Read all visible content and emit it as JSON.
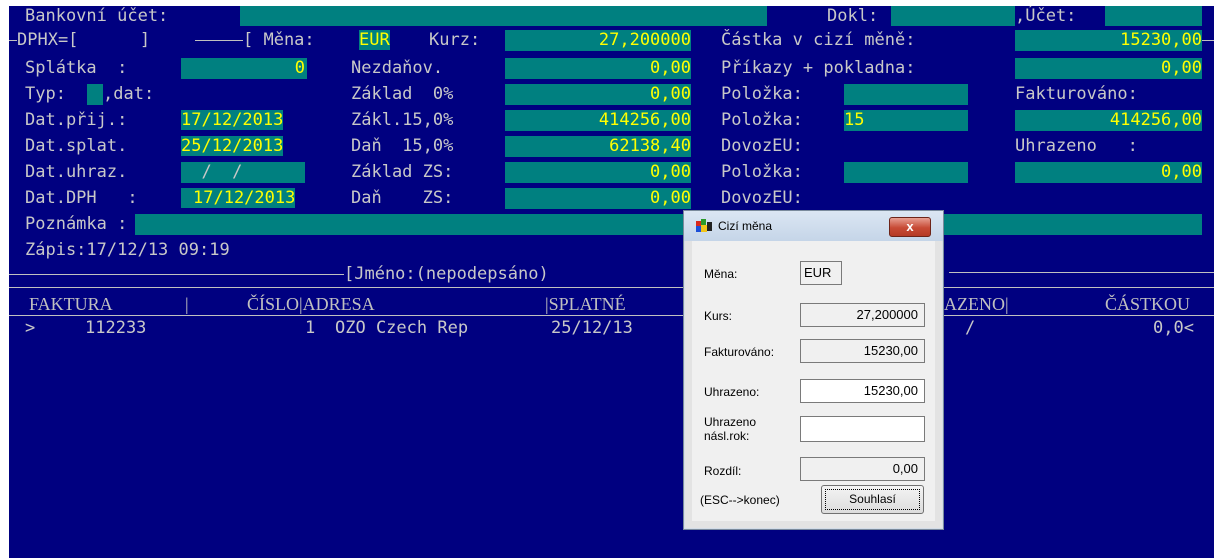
{
  "header": {
    "bank_account_label": "Bankovní účet:",
    "dokl_label": "Dokl:",
    "ucet_label": ",Účet:",
    "dphx_line": "DPHX=[      ]",
    "mena_label": "[ Měna:",
    "mena_value": "EUR",
    "kurz_label": "Kurz:",
    "kurz_value": "27,200000",
    "castka_label": "Částka v cizí měně:",
    "castka_value": "15230,00",
    "splatka_label": "Splátka  :",
    "splatka_value": "0",
    "nezdanov_label": "Nezdaňov.",
    "nezdanov_value": "0,00",
    "prikazy_label": "Příkazy + pokladna:",
    "prikazy_value": "0,00",
    "typ_label": "Typ:",
    "dat_label": ",dat:",
    "zaklad0_label": "Základ  0%",
    "zaklad0_value": "0,00",
    "polozka1_label": "Položka:",
    "fakturovano_label": "Fakturováno:",
    "datprij_label": "Dat.přij.:",
    "datprij_value": "17/12/2013",
    "zakl15_label": "Zákl.15,0%",
    "zakl15_value": "414256,00",
    "polozka2_label": "Položka:",
    "polozka2_value": "15",
    "fakturovano_value": "414256,00",
    "datsplat_label": "Dat.splat.",
    "datsplat_value": "25/12/2013",
    "dan15_label": "Daň  15,0%",
    "dan15_value": "62138,40",
    "dovozeu1_label": "DovozEU:",
    "uhrazeno_label": "Uhrazeno   :",
    "daturhaz_label": "Dat.uhraz.",
    "daturhaz_value": "  /  /",
    "zakladzs_label": "Základ ZS:",
    "zakladzs_value": "0,00",
    "polozka3_label": "Položka:",
    "uhrazeno_value": "0,00",
    "datdph_label": "Dat.DPH   :",
    "datdph_value": "17/12/2013",
    "danzs_label": "Daň    ZS:",
    "danzs_value": "0,00",
    "dovozeu2_label": "DovozEU:",
    "poznamka_label": "Poznámka :",
    "zapis": "Zápis:17/12/13 09:19",
    "jmeno": "[Jméno:(nepodepsáno)"
  },
  "table": {
    "columns": [
      "FAKTURA",
      "|",
      "ČÍSLO|ADRESA",
      "|SPLATNÉ",
      "AZENO|",
      "ČÁSTKOU"
    ],
    "rows": [
      {
        "marker": ">",
        "faktura": "112233",
        "cislo": "1",
        "adresa": "OZO Czech Rep",
        "splatne": "25/12/13",
        "uhrazeno": "/",
        "castka": "0,0<"
      }
    ]
  },
  "dialog": {
    "title": "Cizí měna",
    "close_label": "x",
    "mena_label": "Měna:",
    "mena_value": "EUR",
    "kurs_label": "Kurs:",
    "kurs_value": "27,200000",
    "fakturovano_label": "Fakturováno:",
    "fakturovano_value": "15230,00",
    "uhrazeno_label": "Uhrazeno:",
    "uhrazeno_value": "15230,00",
    "uhrazeno_nasl_label1": "Uhrazeno",
    "uhrazeno_nasl_label2": "násl.rok:",
    "uhrazeno_nasl_value": "",
    "rozdil_label": "Rozdíl:",
    "rozdil_value": "0,00",
    "esc_hint": "(ESC-->konec)",
    "ok_button": "Souhlasí"
  },
  "colors": {
    "background": "#000080",
    "field": "#008080",
    "text": "#c0c0c0",
    "highlight": "#ffff00"
  }
}
